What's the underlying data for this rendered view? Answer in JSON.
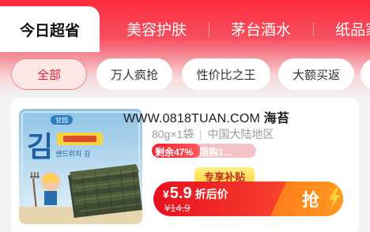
{
  "tabs": [
    {
      "label": "今日超省",
      "active": true
    },
    {
      "label": "美容护肤"
    },
    {
      "label": "茅台酒水"
    },
    {
      "label": "纸品家"
    }
  ],
  "filters": [
    {
      "label": "全部",
      "active": true
    },
    {
      "label": "万人疯抢"
    },
    {
      "label": "性价比之王"
    },
    {
      "label": "大额买返"
    }
  ],
  "product": {
    "title_prefix": "WWW.0818TUAN.COM",
    "title_highlight": "海苔",
    "spec": "80g×1袋",
    "origin": "中国大陆地区",
    "stock_text": "剩余47%",
    "stock_remaining_fraction": 0.47,
    "limit_text": "限购1...",
    "subsidy_label": "专享补贴",
    "currency": "¥",
    "price": "5.9",
    "price_label": "折后价",
    "original_price": "¥14.9",
    "buy_label": "抢",
    "package_brand": "甘园",
    "package_korean_glyph": "김",
    "package_subtitle": "샌드위치 김"
  },
  "colors": {
    "brand_red": "#f5222d",
    "header_red": "#ff2b3d",
    "buy_orange": "#ff8a1e",
    "subsidy_yellow": "#ffd43a"
  }
}
